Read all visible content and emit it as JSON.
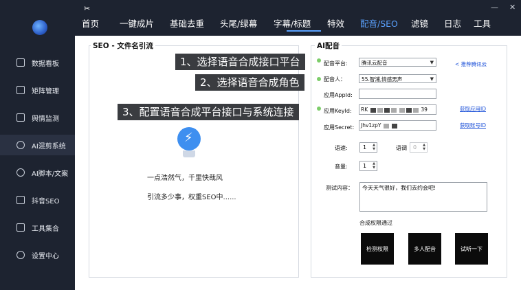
{
  "window": {
    "min_icon": "minimize-icon",
    "close_icon": "close-icon",
    "min_glyph": "—",
    "close_glyph": "✕"
  },
  "sidebar": {
    "items": [
      {
        "label": "数据看板"
      },
      {
        "label": "矩阵管理"
      },
      {
        "label": "舆情监测"
      },
      {
        "label": "AI混剪系统"
      },
      {
        "label": "AI脚本/文案"
      },
      {
        "label": "抖音SEO"
      },
      {
        "label": "工具集合"
      },
      {
        "label": "设置中心"
      }
    ]
  },
  "topnav": {
    "tabs": [
      {
        "label": "首页"
      },
      {
        "label": "一键成片"
      },
      {
        "label": "基础去重"
      },
      {
        "label": "头尾/绿幕"
      },
      {
        "label": "字幕/标题"
      },
      {
        "label": "特效"
      },
      {
        "label": "配音/SEO"
      },
      {
        "label": "滤镜"
      },
      {
        "label": "日志"
      },
      {
        "label": "工具"
      }
    ],
    "active_tab": "配音/SEO"
  },
  "seo_panel": {
    "title": "SEO - 文件名引流",
    "slogan_line1": "一点浩然气，千里快哉风",
    "slogan_line2": "引流多少事，权重SEO中......"
  },
  "ai_panel": {
    "title": "AI配音",
    "platform_label": "配音平台:",
    "platform_value": "腾讯云配音",
    "platform_link": "< 推荐腾讯云",
    "voice_label": "配音人：",
    "voice_value": "55.智浦,情感男声",
    "appid_label": "应用AppId:",
    "appid_value": "",
    "keyid_label": "应用KeyId:",
    "keyid_prefix": "RK",
    "keyid_suffix": "39",
    "keyid_link": "获取应用ID",
    "secret_label": "应用Secret:",
    "secret_prefix": "Jhv1zpY",
    "secret_link": "获取账号ID",
    "speed_label": "语速:",
    "speed_value": "1",
    "pitch_label": "语调",
    "pitch_value": "0",
    "volume_label": "音量:",
    "volume_value": "1",
    "test_label": "测试内容：",
    "test_text": "今天天气很好，我们去约会吧!",
    "status_text": "合成权限通过",
    "btn_check": "检测权限",
    "btn_multi": "多人配音",
    "btn_listen": "试听一下"
  },
  "callouts": {
    "c1": "1、选择语音合成接口平台",
    "c2": "2、选择语音合成角色",
    "c3": "3、配置语音合成平台接口与系统连接"
  },
  "colors": {
    "accent": "#5aa2ff",
    "sidebar_bg": "#1d2330",
    "callout_bg": "#3a3c40",
    "dot": "#7dcd6a"
  }
}
